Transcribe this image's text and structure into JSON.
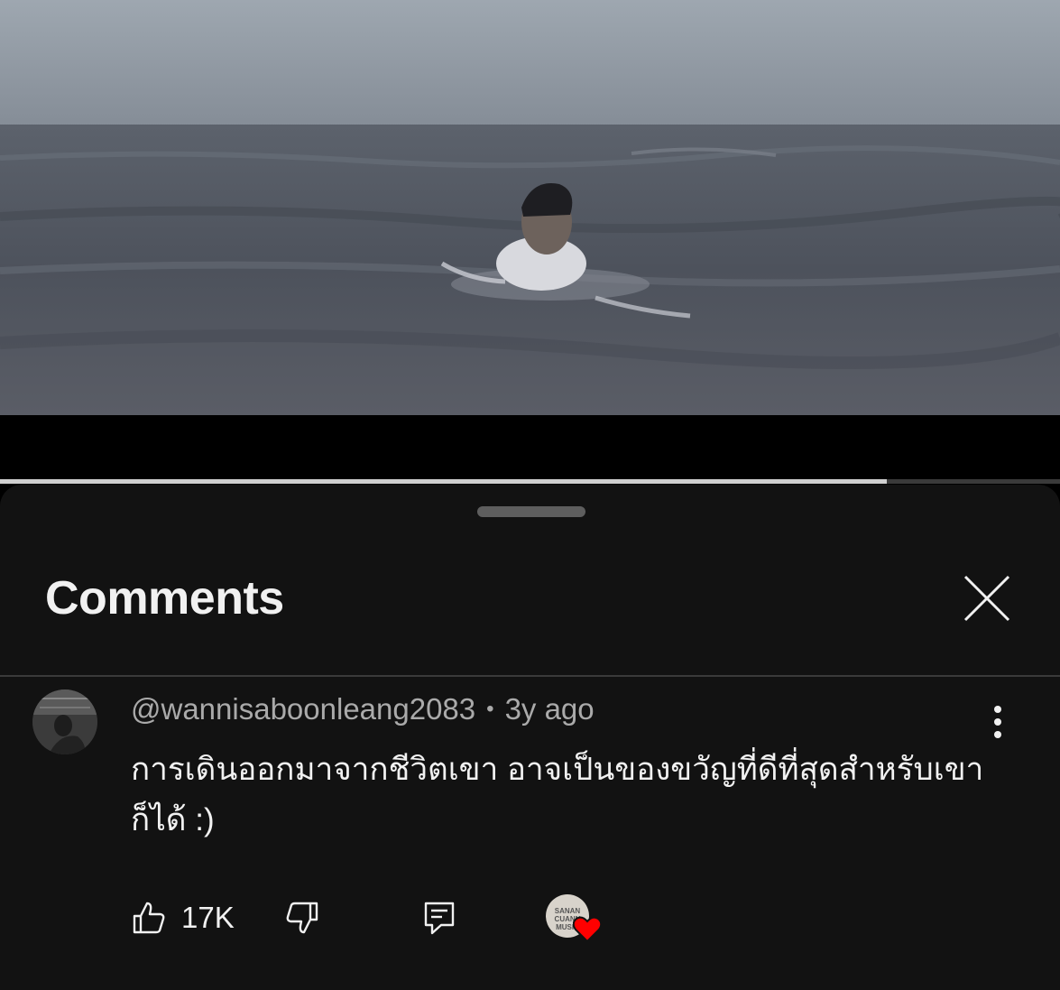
{
  "video": {
    "progress_fraction": 0.837
  },
  "sheet": {
    "title": "Comments"
  },
  "comment": {
    "author": "@wannisaboonleang2083",
    "separator": "•",
    "time": "3y ago",
    "text": "การเดินออกมาจากชีวิตเขา อาจเป็นของขวัญที่ดีที่สุดสำหรับเขาก็ได้ :)",
    "like_count": "17K",
    "creator_avatar_text": "SANAN\nCUANN\nMUSIC"
  },
  "colors": {
    "sheet_bg": "#121212",
    "text_primary": "#f1f1f1",
    "text_secondary": "#aaaaaa",
    "heart": "#ff0000"
  },
  "icons": {
    "close": "close-icon",
    "more": "more-vertical-icon",
    "like": "thumb-up-icon",
    "dislike": "thumb-down-icon",
    "reply": "reply-comment-icon",
    "heart": "creator-heart-icon"
  }
}
